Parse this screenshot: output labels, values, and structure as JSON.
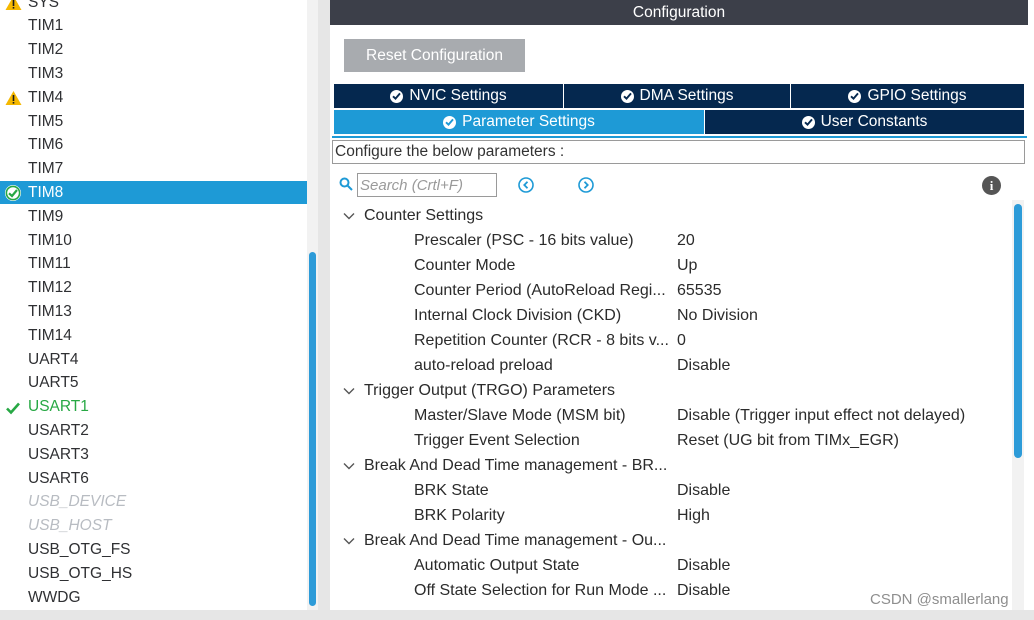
{
  "peripherals": [
    {
      "label": "SYS",
      "state": "warning"
    },
    {
      "label": "TIM1",
      "state": "normal"
    },
    {
      "label": "TIM2",
      "state": "normal"
    },
    {
      "label": "TIM3",
      "state": "normal"
    },
    {
      "label": "TIM4",
      "state": "warning"
    },
    {
      "label": "TIM5",
      "state": "normal"
    },
    {
      "label": "TIM6",
      "state": "normal"
    },
    {
      "label": "TIM7",
      "state": "normal"
    },
    {
      "label": "TIM8",
      "state": "selected"
    },
    {
      "label": "TIM9",
      "state": "normal"
    },
    {
      "label": "TIM10",
      "state": "normal"
    },
    {
      "label": "TIM11",
      "state": "normal"
    },
    {
      "label": "TIM12",
      "state": "normal"
    },
    {
      "label": "TIM13",
      "state": "normal"
    },
    {
      "label": "TIM14",
      "state": "normal"
    },
    {
      "label": "UART4",
      "state": "normal"
    },
    {
      "label": "UART5",
      "state": "normal"
    },
    {
      "label": "USART1",
      "state": "configured"
    },
    {
      "label": "USART2",
      "state": "normal"
    },
    {
      "label": "USART3",
      "state": "normal"
    },
    {
      "label": "USART6",
      "state": "normal"
    },
    {
      "label": "USB_DEVICE",
      "state": "disabled"
    },
    {
      "label": "USB_HOST",
      "state": "disabled"
    },
    {
      "label": "USB_OTG_FS",
      "state": "normal"
    },
    {
      "label": "USB_OTG_HS",
      "state": "normal"
    },
    {
      "label": "WWDG",
      "state": "normal"
    }
  ],
  "config": {
    "header": "Configuration",
    "reset_label": "Reset Configuration",
    "tabs_row1": [
      {
        "label": "NVIC Settings",
        "active": false
      },
      {
        "label": "DMA Settings",
        "active": false
      },
      {
        "label": "GPIO Settings",
        "active": false
      }
    ],
    "tabs_row2": [
      {
        "label": "Parameter Settings",
        "active": true
      },
      {
        "label": "User Constants",
        "active": false
      }
    ],
    "description": "Configure the below parameters :",
    "search_placeholder": "Search (Crtl+F)"
  },
  "tree": [
    {
      "type": "group",
      "label": "Counter Settings"
    },
    {
      "type": "param",
      "name": "Prescaler (PSC - 16 bits value)",
      "value": "20"
    },
    {
      "type": "param",
      "name": "Counter Mode",
      "value": "Up"
    },
    {
      "type": "param",
      "name": "Counter Period (AutoReload Regi...",
      "value": "65535"
    },
    {
      "type": "param",
      "name": "Internal Clock Division (CKD)",
      "value": "No Division"
    },
    {
      "type": "param",
      "name": "Repetition Counter (RCR - 8 bits v...",
      "value": "0"
    },
    {
      "type": "param",
      "name": "auto-reload preload",
      "value": "Disable"
    },
    {
      "type": "group",
      "label": "Trigger Output (TRGO) Parameters"
    },
    {
      "type": "param",
      "name": "Master/Slave Mode (MSM bit)",
      "value": "Disable (Trigger input effect not delayed)"
    },
    {
      "type": "param",
      "name": "Trigger Event Selection",
      "value": "Reset (UG bit from TIMx_EGR)"
    },
    {
      "type": "group",
      "label": "Break And Dead Time management - BR..."
    },
    {
      "type": "param",
      "name": "BRK State",
      "value": "Disable"
    },
    {
      "type": "param",
      "name": "BRK Polarity",
      "value": "High"
    },
    {
      "type": "group",
      "label": "Break And Dead Time management - Ou..."
    },
    {
      "type": "param",
      "name": "Automatic Output State",
      "value": "Disable"
    },
    {
      "type": "param",
      "name": "Off State Selection for Run Mode ...",
      "value": "Disable"
    }
  ],
  "watermark": "CSDN @smallerlang",
  "colors": {
    "accent": "#1e9ad6",
    "tab_dark": "#05284f",
    "header_bg": "#3c3f49",
    "ok_green": "#27a844",
    "warn_yellow": "#f5b800"
  },
  "icons": {
    "warning": "warning-icon",
    "check": "check-icon",
    "selected": "check-circle-icon",
    "search": "search-icon",
    "prev": "arrow-left-circle-icon",
    "next": "arrow-right-circle-icon",
    "info": "info-icon",
    "chevron": "chevron-down-icon"
  }
}
